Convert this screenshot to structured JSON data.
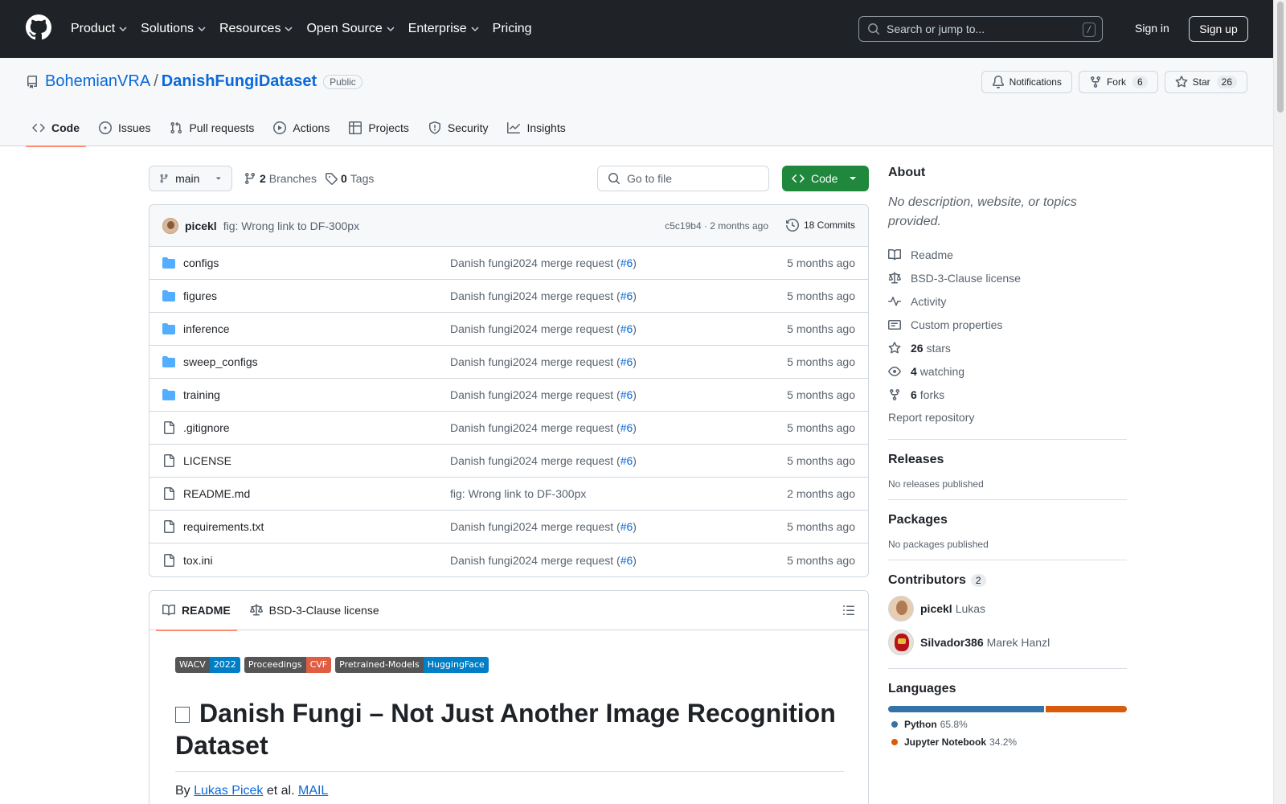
{
  "header": {
    "nav": [
      {
        "label": "Product",
        "dropdown": true
      },
      {
        "label": "Solutions",
        "dropdown": true
      },
      {
        "label": "Resources",
        "dropdown": true
      },
      {
        "label": "Open Source",
        "dropdown": true
      },
      {
        "label": "Enterprise",
        "dropdown": true
      },
      {
        "label": "Pricing",
        "dropdown": false
      }
    ],
    "search_placeholder": "Search or jump to...",
    "search_key": "/",
    "signin": "Sign in",
    "signup": "Sign up"
  },
  "repo": {
    "owner": "BohemianVRA",
    "separator": "/",
    "name": "DanishFungiDataset",
    "visibility": "Public",
    "notifications": "Notifications",
    "fork_label": "Fork",
    "fork_count": "6",
    "star_label": "Star",
    "star_count": "26"
  },
  "tabs": [
    {
      "label": "Code",
      "icon": "code-icon",
      "active": true
    },
    {
      "label": "Issues",
      "icon": "issue-icon"
    },
    {
      "label": "Pull requests",
      "icon": "pull-request-icon"
    },
    {
      "label": "Actions",
      "icon": "play-icon"
    },
    {
      "label": "Projects",
      "icon": "table-icon"
    },
    {
      "label": "Security",
      "icon": "shield-icon"
    },
    {
      "label": "Insights",
      "icon": "graph-icon"
    }
  ],
  "toolbar": {
    "branch": "main",
    "branches_count": "2",
    "branches_label": "Branches",
    "tags_count": "0",
    "tags_label": "Tags",
    "goto_placeholder": "Go to file",
    "code_button": "Code"
  },
  "latest_commit": {
    "author": "picekl",
    "message": "fig: Wrong link to DF-300px",
    "sha_age": "c5c19b4 · 2 months ago",
    "commits": "18 Commits"
  },
  "files": [
    {
      "name": "configs",
      "type": "dir",
      "msg": "Danish fungi2024 merge request (",
      "pr": "#6",
      "msg_end": ")",
      "age": "5 months ago"
    },
    {
      "name": "figures",
      "type": "dir",
      "msg": "Danish fungi2024 merge request (",
      "pr": "#6",
      "msg_end": ")",
      "age": "5 months ago"
    },
    {
      "name": "inference",
      "type": "dir",
      "msg": "Danish fungi2024 merge request (",
      "pr": "#6",
      "msg_end": ")",
      "age": "5 months ago"
    },
    {
      "name": "sweep_configs",
      "type": "dir",
      "msg": "Danish fungi2024 merge request (",
      "pr": "#6",
      "msg_end": ")",
      "age": "5 months ago"
    },
    {
      "name": "training",
      "type": "dir",
      "msg": "Danish fungi2024 merge request (",
      "pr": "#6",
      "msg_end": ")",
      "age": "5 months ago"
    },
    {
      "name": ".gitignore",
      "type": "file",
      "msg": "Danish fungi2024 merge request (",
      "pr": "#6",
      "msg_end": ")",
      "age": "5 months ago"
    },
    {
      "name": "LICENSE",
      "type": "file",
      "msg": "Danish fungi2024 merge request (",
      "pr": "#6",
      "msg_end": ")",
      "age": "5 months ago"
    },
    {
      "name": "README.md",
      "type": "file",
      "msg": "fig: Wrong link to DF-300px",
      "pr": "",
      "msg_end": "",
      "age": "2 months ago"
    },
    {
      "name": "requirements.txt",
      "type": "file",
      "msg": "Danish fungi2024 merge request (",
      "pr": "#6",
      "msg_end": ")",
      "age": "5 months ago"
    },
    {
      "name": "tox.ini",
      "type": "file",
      "msg": "Danish fungi2024 merge request (",
      "pr": "#6",
      "msg_end": ")",
      "age": "5 months ago"
    }
  ],
  "readme": {
    "tab_readme": "README",
    "tab_license": "BSD-3-Clause license",
    "badges": [
      {
        "left": "WACV",
        "right": "2022",
        "color": "#007ec6"
      },
      {
        "left": "Proceedings",
        "right": "CVF",
        "color": "#e05d44"
      },
      {
        "left": "Pretrained-Models",
        "right": "HuggingFace",
        "color": "#007ec6"
      }
    ],
    "heading": "Danish Fungi – Not Just Another Image Recognition Dataset",
    "by": "By",
    "author_link": "Lukas Picek",
    "etal": "et al.",
    "mail_link": "MAIL"
  },
  "about": {
    "title": "About",
    "description": "No description, website, or topics provided.",
    "items": [
      {
        "icon": "book-icon",
        "bold": "",
        "label": "Readme"
      },
      {
        "icon": "law-icon",
        "bold": "",
        "label": "BSD-3-Clause license"
      },
      {
        "icon": "pulse-icon",
        "bold": "",
        "label": "Activity"
      },
      {
        "icon": "note-icon",
        "bold": "",
        "label": "Custom properties"
      },
      {
        "icon": "star-icon",
        "bold": "26",
        "label": "stars"
      },
      {
        "icon": "eye-icon",
        "bold": "4",
        "label": "watching"
      },
      {
        "icon": "fork-icon",
        "bold": "6",
        "label": "forks"
      }
    ],
    "report": "Report repository"
  },
  "releases": {
    "title": "Releases",
    "text": "No releases published"
  },
  "packages": {
    "title": "Packages",
    "text": "No packages published"
  },
  "contributors": {
    "title": "Contributors",
    "count": "2",
    "people": [
      {
        "login": "picekl",
        "name": "Lukas"
      },
      {
        "login": "Silvador386",
        "name": "Marek Hanzl"
      }
    ]
  },
  "languages": {
    "title": "Languages",
    "items": [
      {
        "name": "Python",
        "pct": "65.8%",
        "value": 65.8,
        "color": "#3572A5"
      },
      {
        "name": "Jupyter Notebook",
        "pct": "34.2%",
        "value": 34.2,
        "color": "#DA5B0B"
      }
    ]
  }
}
